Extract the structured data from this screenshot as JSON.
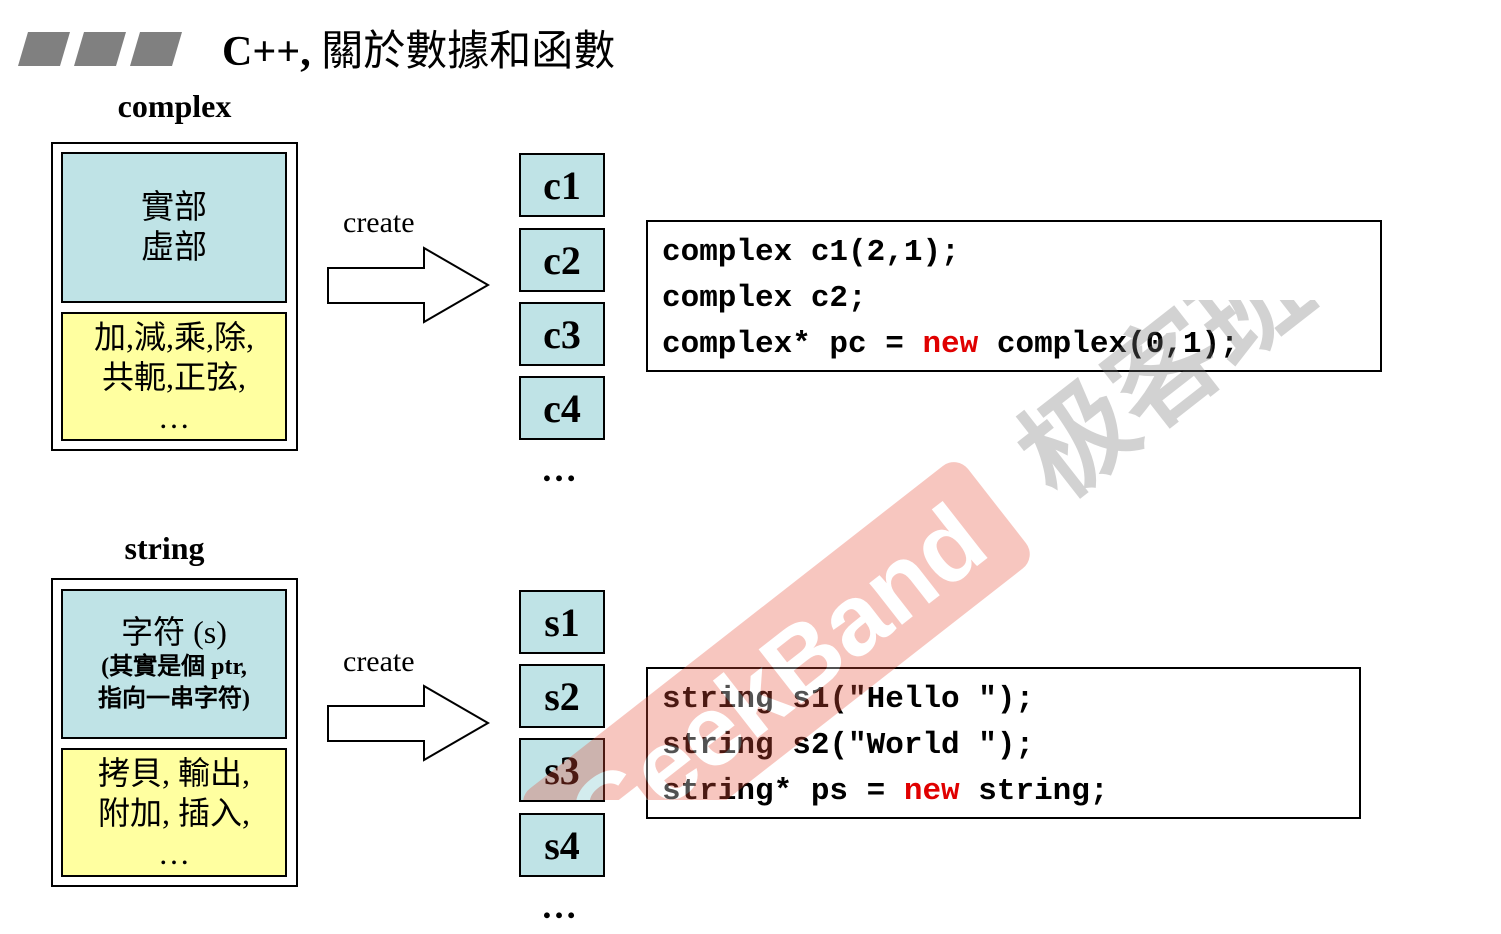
{
  "title": {
    "prefix": "C++,",
    "rest": " 關於數據和函數"
  },
  "complex": {
    "label": "complex",
    "data_lines": [
      "實部",
      "虛部"
    ],
    "func_lines": [
      "加,減,乘,除,",
      "共軛,正弦,",
      "…"
    ],
    "create_label": "create",
    "objects": [
      "c1",
      "c2",
      "c3",
      "c4"
    ],
    "more": "…",
    "code": {
      "line1": "complex c1(2,1);",
      "line2": "complex c2;",
      "line3_pre": "complex* pc = ",
      "line3_kw": "new",
      "line3_post": " complex(0,1);"
    }
  },
  "string": {
    "label": "string",
    "data_lines": [
      "字符 (s)",
      "(其實是個 ptr,",
      "指向一串字符)"
    ],
    "func_lines": [
      "拷貝, 輸出,",
      "附加, 插入,",
      "…"
    ],
    "create_label": "create",
    "objects": [
      "s1",
      "s2",
      "s3",
      "s4"
    ],
    "more": "…",
    "code": {
      "line1": "string s1(\"Hello \");",
      "line2": "string s2(\"World \");",
      "line3_pre": "string* ps = ",
      "line3_kw": "new",
      "line3_post": " string;"
    }
  },
  "watermark": {
    "text_en": "GeekBand",
    "text_cn": "极客班"
  }
}
